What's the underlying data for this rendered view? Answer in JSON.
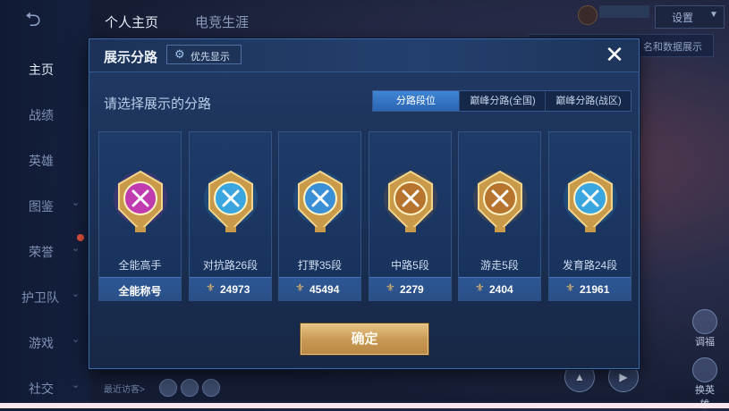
{
  "background": {
    "top_tabs": [
      "个人主页",
      "电竞生涯"
    ],
    "sidebar_items": [
      {
        "label": "主页",
        "active": true,
        "chevron": false
      },
      {
        "label": "战绩",
        "active": false,
        "chevron": false
      },
      {
        "label": "英雄",
        "active": false,
        "chevron": false
      },
      {
        "label": "图鉴",
        "active": false,
        "chevron": true
      },
      {
        "label": "荣誉",
        "active": false,
        "chevron": true
      },
      {
        "label": "护卫队",
        "active": false,
        "chevron": true
      },
      {
        "label": "游戏",
        "active": false,
        "chevron": true
      },
      {
        "label": "社交",
        "active": false,
        "chevron": true
      }
    ],
    "settings_label": "设置",
    "tooltip_text": "名和数据展示",
    "right_icons": [
      {
        "label": "调福"
      },
      {
        "label": "换英雄"
      }
    ],
    "recent_visitors_label": "最近访客>"
  },
  "modal": {
    "title": "展示分路",
    "priority_label": "优先显示",
    "close_symbol": "✕",
    "subtitle": "请选择展示的分路",
    "tabs": [
      {
        "label": "分路段位",
        "active": true
      },
      {
        "label": "巅峰分路(全国)",
        "active": false
      },
      {
        "label": "巅峰分路(战区)",
        "active": false
      }
    ],
    "cards": [
      {
        "name": "全能高手",
        "bar_text": "全能称号",
        "icon": "all-round-medal-icon",
        "color": "#c03ab0",
        "has_points_icon": false
      },
      {
        "name": "对抗路26段",
        "bar_text": "24973",
        "icon": "clash-lane-medal-icon",
        "color": "#3aa6e0",
        "has_points_icon": true
      },
      {
        "name": "打野35段",
        "bar_text": "45494",
        "icon": "jungle-medal-icon",
        "color": "#3a8fd6",
        "has_points_icon": true
      },
      {
        "name": "中路5段",
        "bar_text": "2279",
        "icon": "mid-lane-medal-icon",
        "color": "#b7742f",
        "has_points_icon": true
      },
      {
        "name": "游走5段",
        "bar_text": "2404",
        "icon": "roam-medal-icon",
        "color": "#b7742f",
        "has_points_icon": true
      },
      {
        "name": "发育路24段",
        "bar_text": "21961",
        "icon": "farm-lane-medal-icon",
        "color": "#3aa6e0",
        "has_points_icon": true
      }
    ],
    "confirm_label": "确定"
  }
}
